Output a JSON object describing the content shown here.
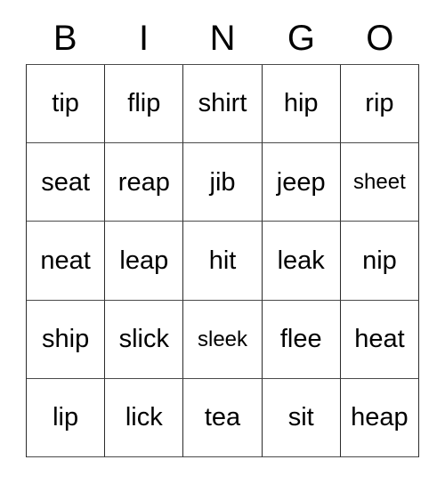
{
  "card": {
    "title": "BINGO",
    "header_letters": [
      "B",
      "I",
      "N",
      "G",
      "O"
    ],
    "grid_size": "5x5",
    "text_color": "#000000",
    "border_color": "#2b2b2b",
    "background_color": "#ffffff",
    "rows": [
      {
        "cells": [
          {
            "text": "tip",
            "fit": "normal"
          },
          {
            "text": "flip",
            "fit": "normal"
          },
          {
            "text": "shirt",
            "fit": "normal"
          },
          {
            "text": "hip",
            "fit": "normal"
          },
          {
            "text": "rip",
            "fit": "normal"
          }
        ]
      },
      {
        "cells": [
          {
            "text": "seat",
            "fit": "normal"
          },
          {
            "text": "reap",
            "fit": "normal"
          },
          {
            "text": "jib",
            "fit": "normal"
          },
          {
            "text": "jeep",
            "fit": "normal"
          },
          {
            "text": "sheet",
            "fit": "shrink"
          }
        ]
      },
      {
        "cells": [
          {
            "text": "neat",
            "fit": "normal"
          },
          {
            "text": "leap",
            "fit": "normal"
          },
          {
            "text": "hit",
            "fit": "normal"
          },
          {
            "text": "leak",
            "fit": "normal"
          },
          {
            "text": "nip",
            "fit": "normal"
          }
        ]
      },
      {
        "cells": [
          {
            "text": "ship",
            "fit": "normal"
          },
          {
            "text": "slick",
            "fit": "normal"
          },
          {
            "text": "sleek",
            "fit": "shrink"
          },
          {
            "text": "flee",
            "fit": "normal"
          },
          {
            "text": "heat",
            "fit": "normal"
          }
        ]
      },
      {
        "cells": [
          {
            "text": "lip",
            "fit": "normal"
          },
          {
            "text": "lick",
            "fit": "normal"
          },
          {
            "text": "tea",
            "fit": "normal"
          },
          {
            "text": "sit",
            "fit": "normal"
          },
          {
            "text": "heap",
            "fit": "normal"
          }
        ]
      }
    ]
  }
}
